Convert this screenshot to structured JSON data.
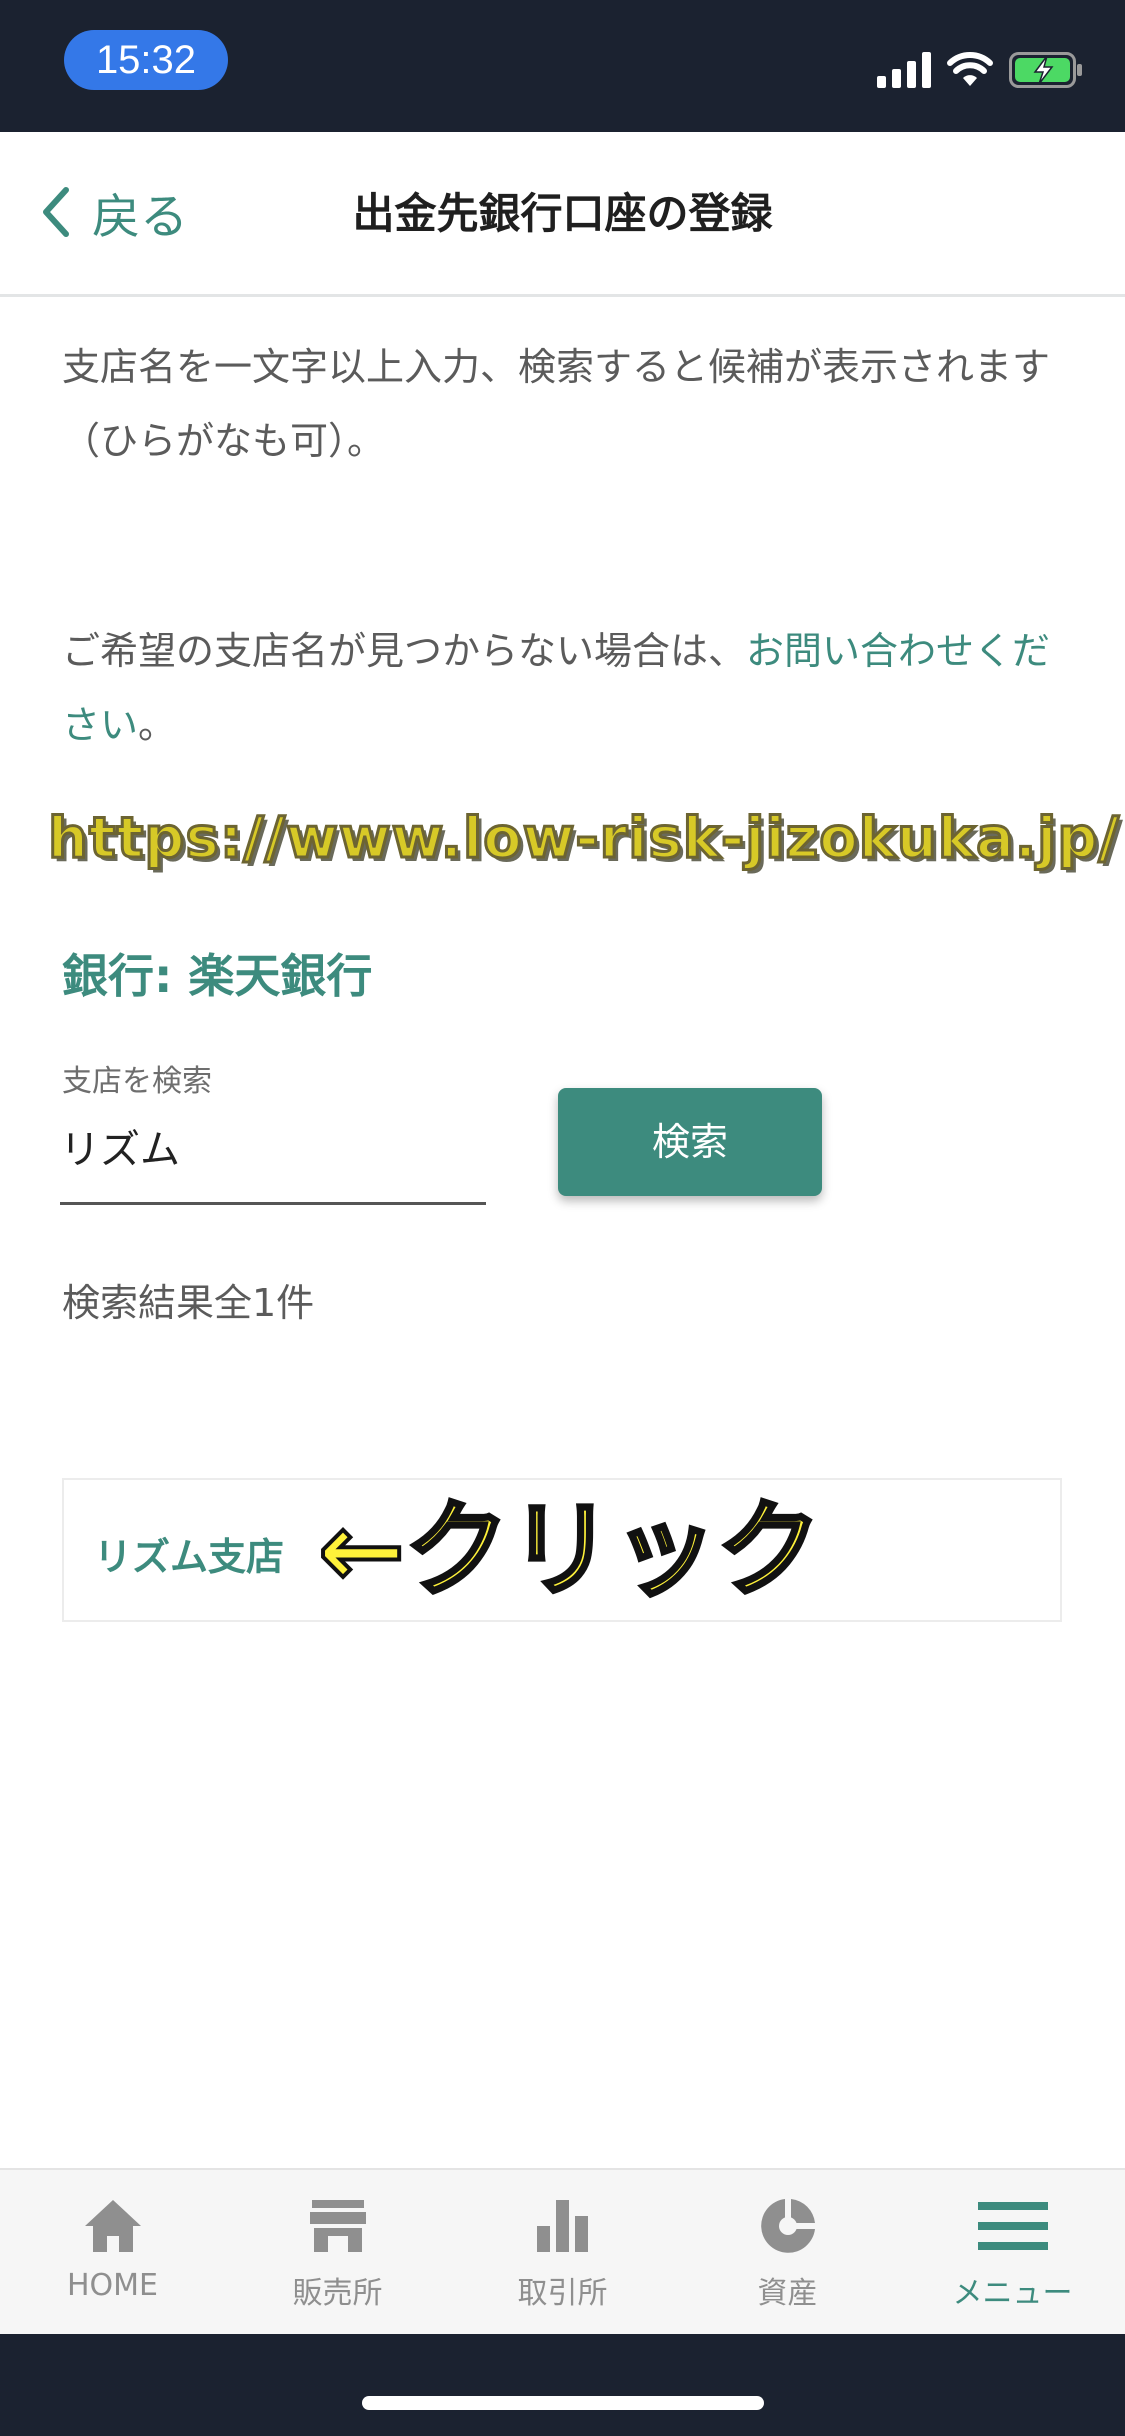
{
  "status_bar": {
    "time": "15:32",
    "icons": [
      "signal-icon",
      "wifi-icon",
      "battery-charging-icon"
    ]
  },
  "header": {
    "back_label": "戻る",
    "title": "出金先銀行口座の登録"
  },
  "content": {
    "instruction": "支店名を一文字以上入力、検索すると候補が表示されます（ひらがなも可）。",
    "not_found_prefix": "ご希望の支店名が見つからない場合は、",
    "contact_link": "お問い合わせください",
    "not_found_suffix": "。",
    "watermark": "https://www.low-risk-jizokuka.jp/",
    "bank_label": "銀行: 楽天銀行",
    "branch_search": {
      "label": "支店を検索",
      "value": "リズム"
    },
    "search_button": "検索",
    "result_count": "検索結果全1件",
    "results": [
      {
        "label": "リズム支店"
      }
    ],
    "click_annotation": "←クリック"
  },
  "tab_bar": {
    "tabs": [
      {
        "label": "HOME",
        "icon": "home-icon"
      },
      {
        "label": "販売所",
        "icon": "store-icon"
      },
      {
        "label": "取引所",
        "icon": "bar-chart-icon"
      },
      {
        "label": "資産",
        "icon": "pie-chart-icon"
      },
      {
        "label": "メニュー",
        "icon": "menu-icon",
        "active": true
      }
    ]
  },
  "colors": {
    "accent": "#3d8b7e",
    "status_bar": "#1b2230",
    "time_pill": "#3478e8"
  }
}
